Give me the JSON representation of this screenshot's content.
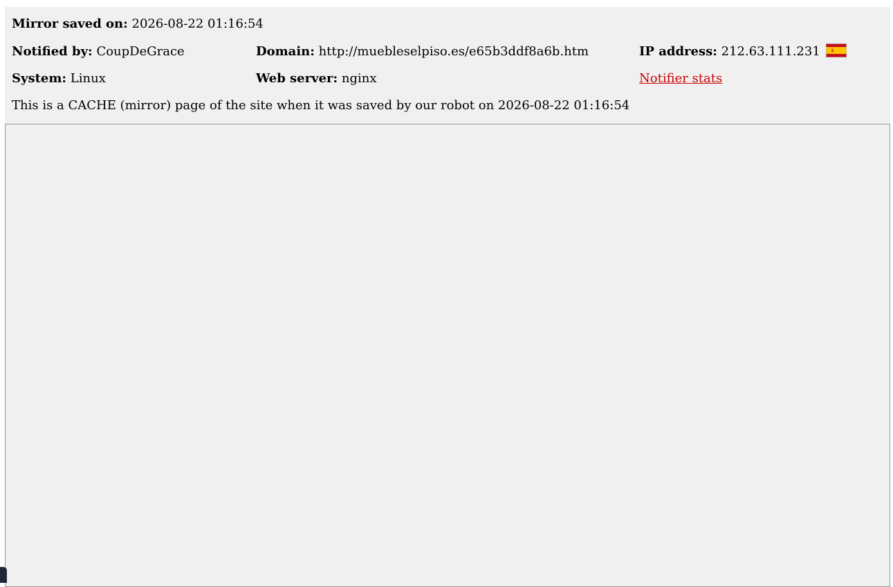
{
  "mirror_info": {
    "saved": {
      "label": "Mirror saved on:",
      "value": "2026-08-22 01:16:54"
    },
    "notified_by": {
      "label": "Notified by:",
      "value": "CoupDeGrace"
    },
    "domain": {
      "label": "Domain:",
      "value": "http://muebleselpiso.es/e65b3ddf8a6b.htm"
    },
    "ip_address": {
      "label": "IP address:",
      "value": "212.63.111.231",
      "flag_icon": "spain-flag-icon"
    },
    "system": {
      "label": "System:",
      "value": "Linux"
    },
    "web_server": {
      "label": "Web server:",
      "value": "nginx"
    },
    "notifier_stats_link": "Notifier stats",
    "cache_notice": "This is a CACHE (mirror) page of the site when it was saved by our robot on 2026-08-22 01:16:54"
  },
  "colors": {
    "header_background": "#f0f0f0",
    "link": "#cc0000",
    "frame_border": "#999999",
    "flag_red": "#c60b1e",
    "flag_yellow": "#ffc400"
  }
}
